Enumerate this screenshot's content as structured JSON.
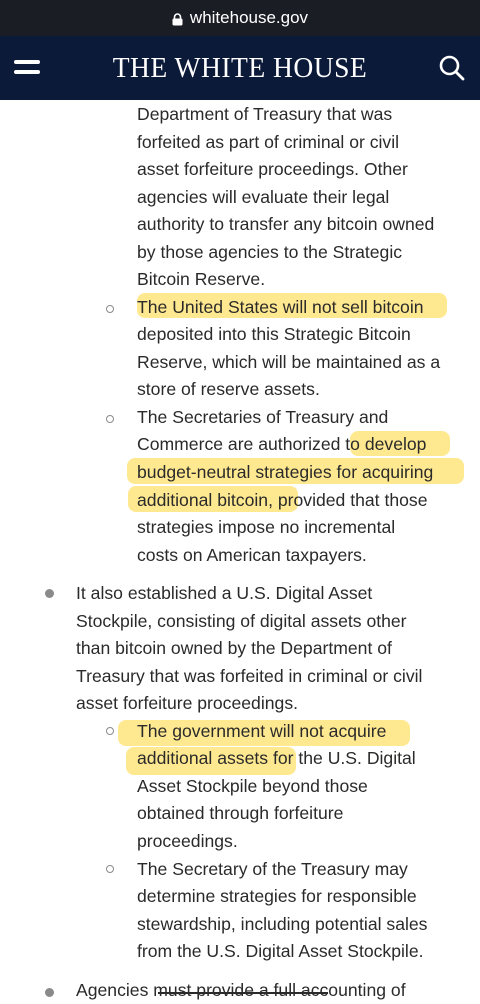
{
  "browser": {
    "url": "whitehouse.gov"
  },
  "header": {
    "title": "THE WHITE HOUSE"
  },
  "colors": {
    "header_bg": "#0c1a3a",
    "highlight": "#ffe88a",
    "text": "#2a2a2a"
  },
  "article": {
    "lines": [
      "Department of Treasury that was",
      "forfeited as part of criminal or civil",
      "asset forfeiture proceedings.  Other",
      "agencies will evaluate their legal",
      "authority to transfer any bitcoin owned",
      "by those agencies to the Strategic",
      "Bitcoin Reserve.",
      "The United States will not sell bitcoin",
      "deposited into this Strategic Bitcoin",
      "Reserve, which will be maintained as a",
      "store of reserve assets.",
      "The Secretaries of Treasury and",
      "Commerce are authorized to develop",
      "budget-neutral strategies for acquiring",
      "additional bitcoin, provided that those",
      "strategies impose no incremental",
      "costs on American taxpayers.",
      "It also established a U.S. Digital Asset",
      "Stockpile, consisting of digital assets other",
      "than bitcoin owned by the Department of",
      "Treasury that was forfeited in criminal or civil",
      "asset forfeiture proceedings.",
      "The government will not acquire",
      "additional assets for the U.S. Digital",
      "Asset Stockpile beyond those",
      "obtained through forfeiture",
      "proceedings.",
      "The Secretary of the Treasury may",
      "determine strategies for responsible",
      "stewardship, including potential sales",
      "from the U.S. Digital Asset Stockpile.",
      "Agencies must provide a full accounting of"
    ]
  }
}
